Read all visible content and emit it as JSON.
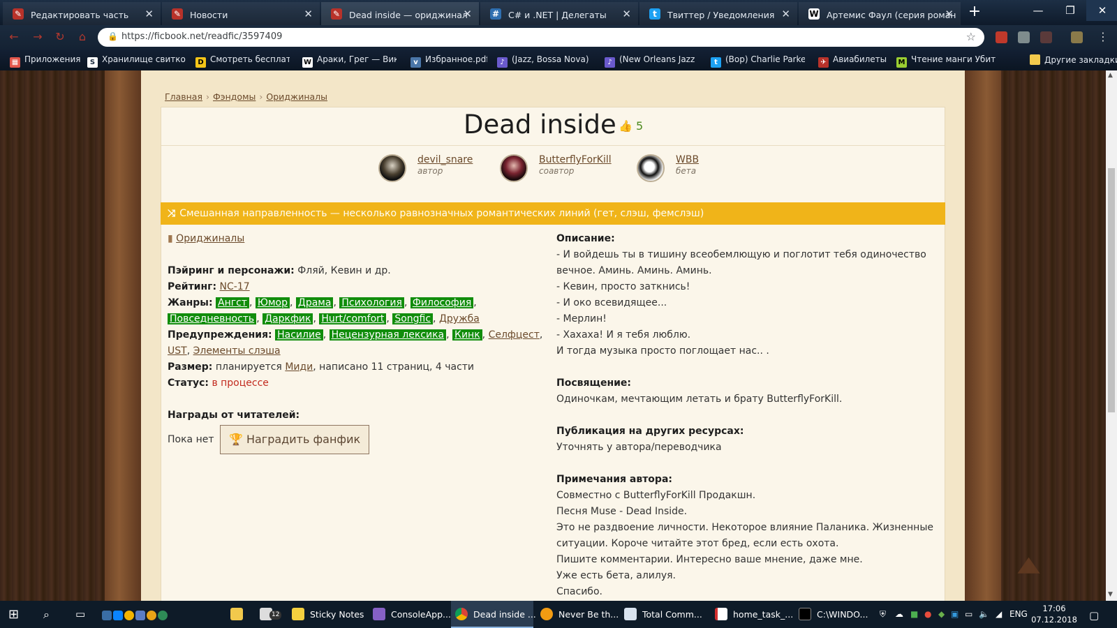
{
  "browser": {
    "tabs": [
      {
        "label": "Редактировать часть",
        "favicon": "pen-icon",
        "active": false
      },
      {
        "label": "Новости",
        "favicon": "pen-icon",
        "active": false
      },
      {
        "label": "Dead inside — ориджинал",
        "favicon": "pen-icon",
        "active": true
      },
      {
        "label": "C# и .NET | Делегаты",
        "favicon": "csharp-icon",
        "active": false
      },
      {
        "label": "Твиттер / Уведомления",
        "favicon": "twitter-icon",
        "active": false
      },
      {
        "label": "Артемис Фаул (серия роман",
        "favicon": "wikipedia-icon",
        "active": false
      }
    ],
    "url": "https://ficbook.net/readfic/3597409",
    "bookmarks": [
      {
        "label": "Приложения"
      },
      {
        "label": "Хранилище свитко"
      },
      {
        "label": "Смотреть бесплатн"
      },
      {
        "label": "Араки, Грег — Вик"
      },
      {
        "label": "Избранное.pdf"
      },
      {
        "label": "(Jazz, Bossa Nova) (J"
      },
      {
        "label": "(New Orleans Jazz,"
      },
      {
        "label": "(Bop) Charlie Parker"
      },
      {
        "label": "Авиабилеты"
      },
      {
        "label": "Чтение манги Убит"
      },
      {
        "label": "Другие закладки"
      }
    ]
  },
  "page": {
    "breadcrumbs": [
      "Главная",
      "Фэндомы",
      "Ориджиналы"
    ],
    "title": "Dead inside",
    "likes": "5",
    "people": [
      {
        "name": "devil_snare",
        "role": "автор"
      },
      {
        "name": "ButterflyForKill",
        "role": "соавтор"
      },
      {
        "name": "WBB",
        "role": "бета"
      }
    ],
    "direction_banner": "Смешанная направленность — несколько равнозначных романтических линий (гет, слэш, фемслэш)",
    "fandom_link": "Ориджиналы",
    "pairing_label": "Пэйринг и персонажи:",
    "pairing_value": "Фляй, Кевин и др.",
    "rating_label": "Рейтинг:",
    "rating_value": "NC-17",
    "genres_label": "Жанры:",
    "genres": [
      {
        "label": "Ангст",
        "highlight": true
      },
      {
        "label": "Юмор",
        "highlight": true
      },
      {
        "label": "Драма",
        "highlight": true
      },
      {
        "label": "Психология",
        "highlight": true
      },
      {
        "label": "Философия",
        "highlight": true
      },
      {
        "label": "Повседневность",
        "highlight": true
      },
      {
        "label": "Даркфик",
        "highlight": true
      },
      {
        "label": "Hurt/comfort",
        "highlight": true
      },
      {
        "label": "Songfic",
        "highlight": true
      },
      {
        "label": "Дружба",
        "highlight": false
      }
    ],
    "warnings_label": "Предупреждения:",
    "warnings": [
      {
        "label": "Насилие",
        "highlight": true
      },
      {
        "label": "Нецензурная лексика",
        "highlight": true
      },
      {
        "label": "Кинк",
        "highlight": true
      },
      {
        "label": "Селфцест",
        "highlight": false
      },
      {
        "label": "UST",
        "highlight": false
      },
      {
        "label": "Элементы слэша",
        "highlight": false
      }
    ],
    "size_label": "Размер:",
    "size_prefix": "планируется",
    "size_link": "Миди",
    "size_suffix": ", написано 11 страниц, 4 части",
    "status_label": "Статус:",
    "status_value": "в процессе",
    "awards_label": "Награды от читателей:",
    "awards_none": "Пока нет",
    "award_button": "Наградить фанфик",
    "description_label": "Описание:",
    "description_lines": [
      "- И войдешь ты в тишину всеобемлющую и поглотит тебя одиночество",
      "вечное. Аминь. Аминь. Аминь.",
      "- Кевин, просто заткнись!",
      "- И око всевидящее...",
      "- Мерлин!",
      "- Хахаха! И я тебя люблю.",
      "И тогда музыка просто поглощает нас.. ."
    ],
    "dedication_label": "Посвящение:",
    "dedication_text": "Одиночкам, мечтающим летать и брату ButterflyForKill.",
    "publication_label": "Публикация на других ресурсах:",
    "publication_text": "Уточнять у автора/переводчика",
    "notes_label": "Примечания автора:",
    "notes_lines": [
      "Совместно с ButterflyForKill Продакшн.",
      "Песня Muse - Dead Inside.",
      "Это не раздвоение личности. Некоторое влияние Паланика. Жизненные",
      "ситуации. Короче читайте этот бред, если есть охота.",
      "Пишите комментарии. Интересно ваше мнение, даже мне.",
      "Уже есть бета, алилуя.",
      "Спасибо."
    ]
  },
  "taskbar": {
    "apps": [
      {
        "label": "Sticky Notes"
      },
      {
        "label": "ConsoleApp..."
      },
      {
        "label": "Dead inside ..."
      },
      {
        "label": "Never Be th..."
      },
      {
        "label": "Total Comm..."
      },
      {
        "label": "home_task_..."
      },
      {
        "label": "C:\\WINDO..."
      }
    ],
    "mail_badge": "12",
    "language": "ENG",
    "time": "17:06",
    "date": "07.12.2018"
  },
  "colors": {
    "banner": "#f0b419",
    "tag_green": "#118d0c",
    "status_red": "#c22a1e",
    "link_brown": "#6b4a2b"
  }
}
